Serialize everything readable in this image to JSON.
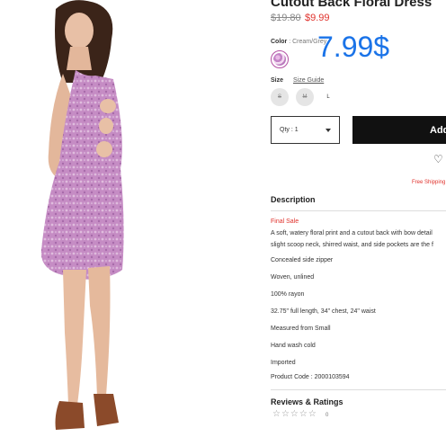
{
  "product": {
    "title": "Cutout Back Floral Dress",
    "price_original": "$19.80",
    "price_sale": "$9.99",
    "overlay_price": "7.99$"
  },
  "color": {
    "label": "Color",
    "separator": " : ",
    "value": "Cream/Grey"
  },
  "size": {
    "label": "Size",
    "guide_label": "Size Guide",
    "options": [
      "S",
      "M",
      "L"
    ]
  },
  "cart": {
    "qty_label": "Qty : 1",
    "add_label": "Add"
  },
  "shipping_note": "Free Shipping",
  "description": {
    "heading": "Description",
    "final_sale": "Final Sale",
    "text_line1": "A soft, watery floral print and a cutout back with bow detail",
    "text_line2": "slight scoop neck, shirred waist, and side pockets are the f",
    "details": [
      "Concealed side zipper",
      "Woven, unlined",
      "100% rayon",
      "32.75\" full length, 34\" chest, 24\" waist",
      "Measured from Small",
      "Hand wash cold",
      "Imported"
    ],
    "product_code": "Product Code : 2000103594"
  },
  "reviews": {
    "heading": "Reviews & Ratings",
    "stars": "☆☆☆☆☆",
    "count": "0"
  },
  "colors": {
    "sale_red": "#e0322c",
    "overlay_blue": "#1a73e8",
    "button_black": "#111111"
  }
}
